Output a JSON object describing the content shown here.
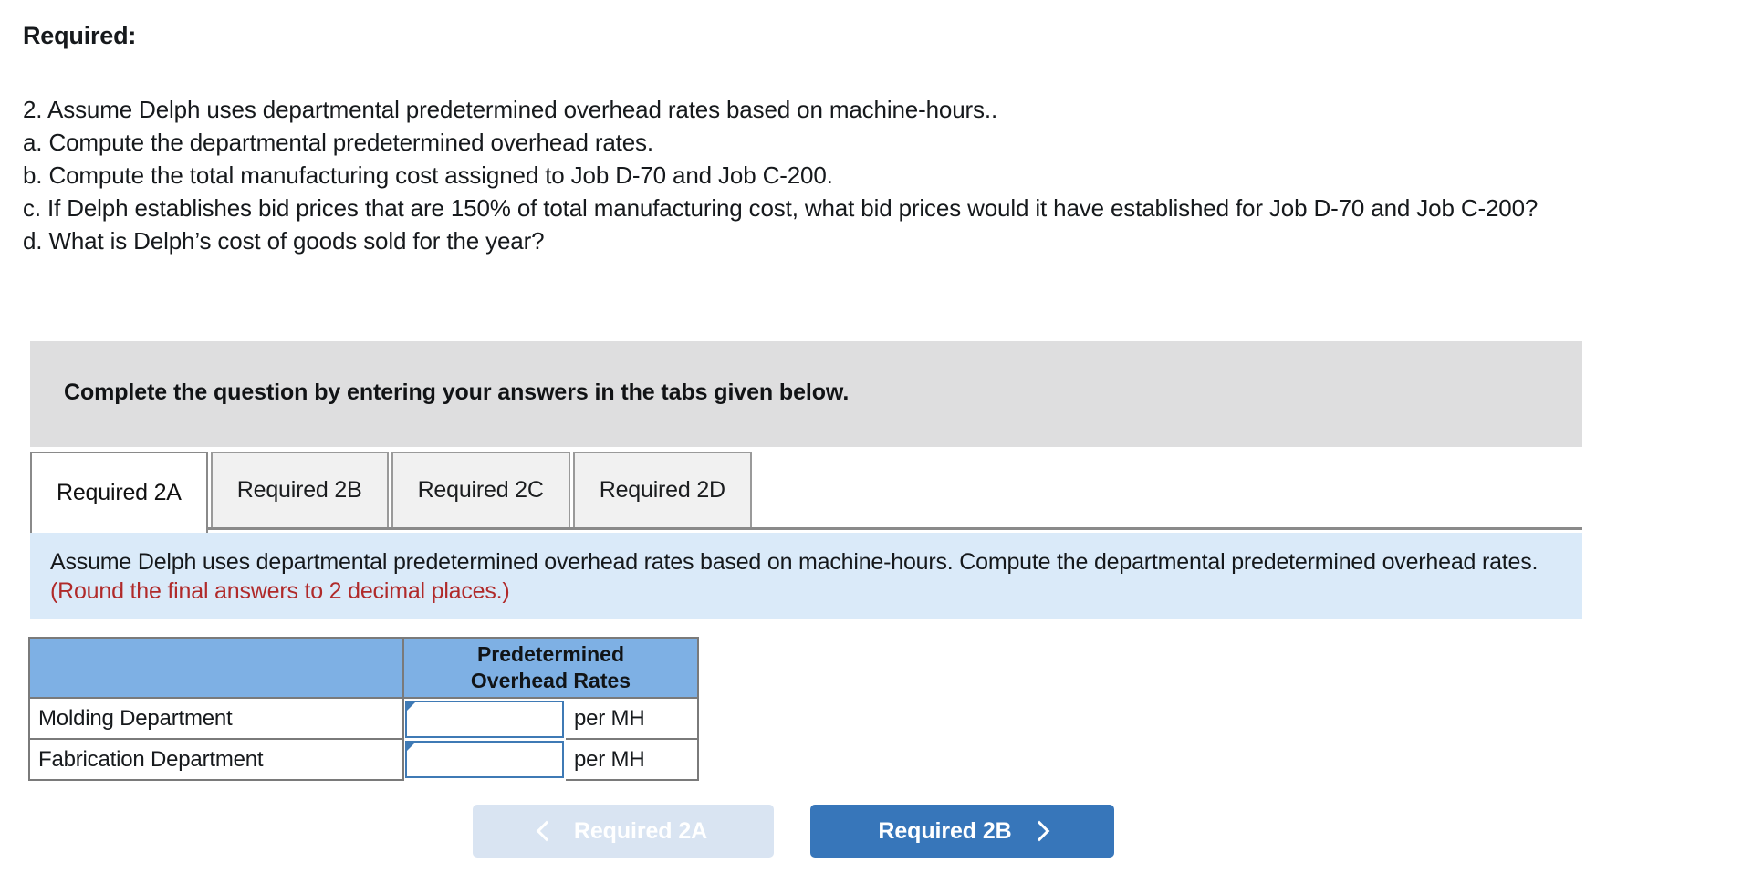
{
  "required_heading": "Required:",
  "question": {
    "lines": [
      "2. Assume Delph uses departmental predetermined overhead rates based on machine-hours..",
      "a. Compute the departmental predetermined overhead rates.",
      "b. Compute the total manufacturing cost assigned to Job D-70 and Job C-200.",
      "c. If Delph establishes bid prices that are 150% of total manufacturing cost, what bid prices would it have established for Job D-70 and Job C-200?",
      "d. What is Delph’s cost of goods sold for the year?"
    ]
  },
  "banner": {
    "text": "Complete the question by entering your answers in the tabs given below."
  },
  "tabs": [
    {
      "label": "Required 2A",
      "active": true
    },
    {
      "label": "Required 2B",
      "active": false
    },
    {
      "label": "Required 2C",
      "active": false
    },
    {
      "label": "Required 2D",
      "active": false
    }
  ],
  "info_panel": {
    "text": "Assume Delph uses departmental predetermined overhead rates based on machine-hours. Compute the departmental predetermined overhead rates.",
    "round_note": "(Round the final answers to 2 decimal places.)"
  },
  "table": {
    "header_blank": "",
    "header_rate_line1": "Predetermined",
    "header_rate_line2": "Overhead Rates",
    "rows": [
      {
        "label": "Molding Department",
        "value": "",
        "unit": "per MH"
      },
      {
        "label": "Fabrication Department",
        "value": "",
        "unit": "per MH"
      }
    ]
  },
  "nav": {
    "prev_label": "Required 2A",
    "next_label": "Required 2B"
  },
  "colors": {
    "banner_gray": "#dededf",
    "info_blue": "#daeaf9",
    "table_header_blue": "#7eb0e4",
    "input_border_blue": "#3f7ab5",
    "next_button_blue": "#3776ba",
    "prev_button_blue": "#d9e4f2",
    "round_note_red": "#b02a2a"
  }
}
